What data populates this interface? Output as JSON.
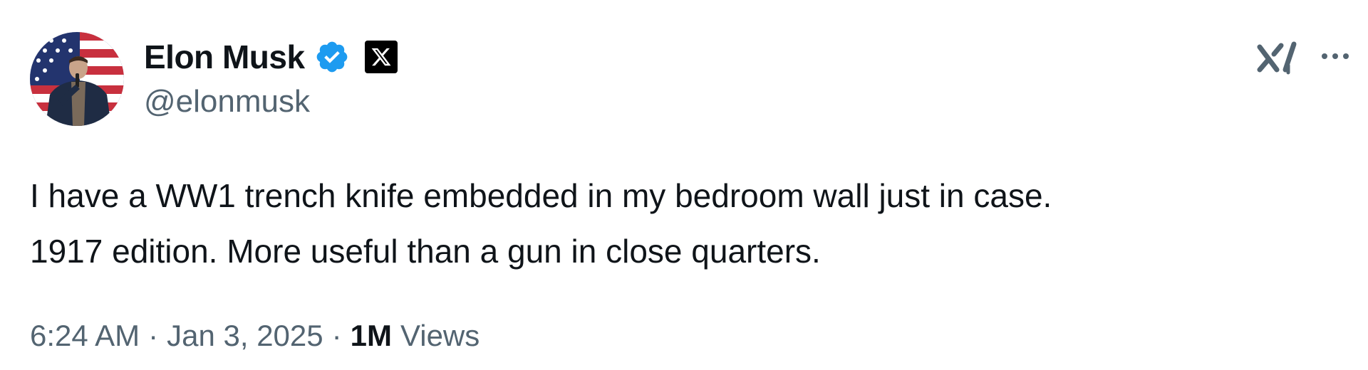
{
  "tweet": {
    "author": {
      "display_name": "Elon Musk",
      "handle": "@elonmusk",
      "verified": true,
      "affiliate_badge": "x-logo"
    },
    "text_lines": [
      "I have a WW1 trench knife embedded in my bedroom wall just in case.",
      "1917 edition. More useful than a gun in close quarters."
    ],
    "meta": {
      "time": "6:24 AM",
      "separator": "·",
      "date": "Jan 3, 2025",
      "views_count": "1M",
      "views_label": "Views"
    },
    "actions": {
      "grok_icon": "grok-icon",
      "more_icon": "more-icon"
    }
  },
  "colors": {
    "text_primary": "#0f1419",
    "text_secondary": "#536471",
    "verified_blue": "#1d9bf0",
    "background": "#ffffff"
  }
}
